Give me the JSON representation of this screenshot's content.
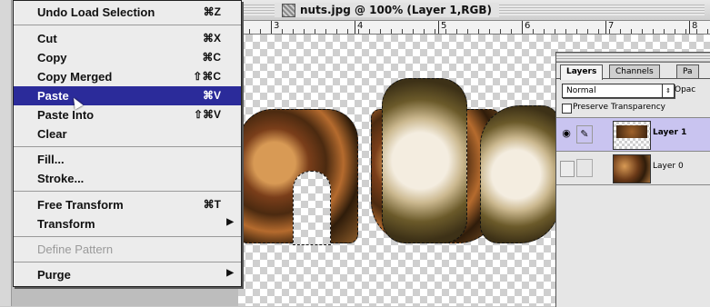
{
  "document": {
    "title": "nuts.jpg @ 100% (Layer 1,RGB)",
    "ruler_numbers": [
      "3",
      "4",
      "5",
      "6",
      "7",
      "8"
    ]
  },
  "menu": {
    "items": [
      {
        "label": "Undo Load Selection",
        "shortcut": "⌘Z"
      },
      {
        "label": "Cut",
        "shortcut": "⌘X"
      },
      {
        "label": "Copy",
        "shortcut": "⌘C"
      },
      {
        "label": "Copy Merged",
        "shortcut": "⇧⌘C"
      },
      {
        "label": "Paste",
        "shortcut": "⌘V"
      },
      {
        "label": "Paste Into",
        "shortcut": "⇧⌘V"
      },
      {
        "label": "Clear",
        "shortcut": ""
      },
      {
        "label": "Fill...",
        "shortcut": ""
      },
      {
        "label": "Stroke...",
        "shortcut": ""
      },
      {
        "label": "Free Transform",
        "shortcut": "⌘T"
      },
      {
        "label": "Transform",
        "shortcut": ""
      },
      {
        "label": "Define Pattern",
        "shortcut": ""
      },
      {
        "label": "Purge",
        "shortcut": ""
      }
    ],
    "highlighted": "Paste",
    "disabled": [
      "Define Pattern"
    ],
    "submenu_arrow": "▶"
  },
  "layers_palette": {
    "tabs": [
      "Layers",
      "Channels",
      "Pa"
    ],
    "blend_mode": "Normal",
    "blend_arrow": "⇕",
    "opacity_label": "Opac",
    "preserve_transparency": "Preserve Transparency",
    "layers": [
      {
        "name": "Layer 1",
        "selected": true,
        "visible": true
      },
      {
        "name": "Layer 0",
        "selected": false,
        "visible": false
      }
    ],
    "eye_glyph": "◉",
    "brush_glyph": "✎"
  },
  "colors": {
    "menu_highlight": "#2b2b9a",
    "selected_layer": "#c9c4f0"
  }
}
